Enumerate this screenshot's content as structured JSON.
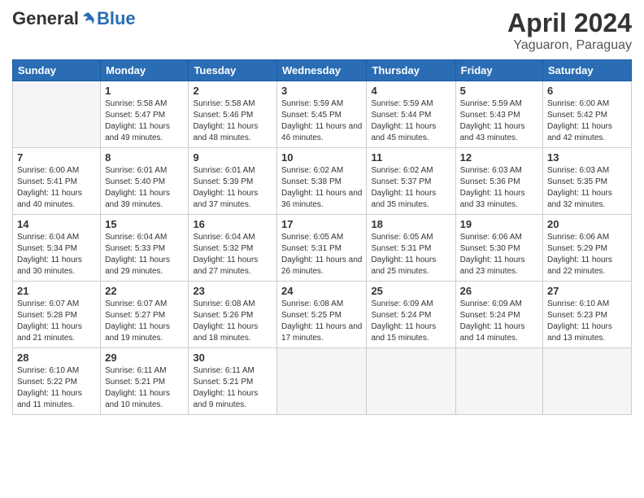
{
  "header": {
    "logo_general": "General",
    "logo_blue": "Blue",
    "month_title": "April 2024",
    "location": "Yaguaron, Paraguay"
  },
  "days_of_week": [
    "Sunday",
    "Monday",
    "Tuesday",
    "Wednesday",
    "Thursday",
    "Friday",
    "Saturday"
  ],
  "weeks": [
    [
      {
        "day": "",
        "info": ""
      },
      {
        "day": "1",
        "info": "Sunrise: 5:58 AM\nSunset: 5:47 PM\nDaylight: 11 hours\nand 49 minutes."
      },
      {
        "day": "2",
        "info": "Sunrise: 5:58 AM\nSunset: 5:46 PM\nDaylight: 11 hours\nand 48 minutes."
      },
      {
        "day": "3",
        "info": "Sunrise: 5:59 AM\nSunset: 5:45 PM\nDaylight: 11 hours\nand 46 minutes."
      },
      {
        "day": "4",
        "info": "Sunrise: 5:59 AM\nSunset: 5:44 PM\nDaylight: 11 hours\nand 45 minutes."
      },
      {
        "day": "5",
        "info": "Sunrise: 5:59 AM\nSunset: 5:43 PM\nDaylight: 11 hours\nand 43 minutes."
      },
      {
        "day": "6",
        "info": "Sunrise: 6:00 AM\nSunset: 5:42 PM\nDaylight: 11 hours\nand 42 minutes."
      }
    ],
    [
      {
        "day": "7",
        "info": "Sunrise: 6:00 AM\nSunset: 5:41 PM\nDaylight: 11 hours\nand 40 minutes."
      },
      {
        "day": "8",
        "info": "Sunrise: 6:01 AM\nSunset: 5:40 PM\nDaylight: 11 hours\nand 39 minutes."
      },
      {
        "day": "9",
        "info": "Sunrise: 6:01 AM\nSunset: 5:39 PM\nDaylight: 11 hours\nand 37 minutes."
      },
      {
        "day": "10",
        "info": "Sunrise: 6:02 AM\nSunset: 5:38 PM\nDaylight: 11 hours\nand 36 minutes."
      },
      {
        "day": "11",
        "info": "Sunrise: 6:02 AM\nSunset: 5:37 PM\nDaylight: 11 hours\nand 35 minutes."
      },
      {
        "day": "12",
        "info": "Sunrise: 6:03 AM\nSunset: 5:36 PM\nDaylight: 11 hours\nand 33 minutes."
      },
      {
        "day": "13",
        "info": "Sunrise: 6:03 AM\nSunset: 5:35 PM\nDaylight: 11 hours\nand 32 minutes."
      }
    ],
    [
      {
        "day": "14",
        "info": "Sunrise: 6:04 AM\nSunset: 5:34 PM\nDaylight: 11 hours\nand 30 minutes."
      },
      {
        "day": "15",
        "info": "Sunrise: 6:04 AM\nSunset: 5:33 PM\nDaylight: 11 hours\nand 29 minutes."
      },
      {
        "day": "16",
        "info": "Sunrise: 6:04 AM\nSunset: 5:32 PM\nDaylight: 11 hours\nand 27 minutes."
      },
      {
        "day": "17",
        "info": "Sunrise: 6:05 AM\nSunset: 5:31 PM\nDaylight: 11 hours\nand 26 minutes."
      },
      {
        "day": "18",
        "info": "Sunrise: 6:05 AM\nSunset: 5:31 PM\nDaylight: 11 hours\nand 25 minutes."
      },
      {
        "day": "19",
        "info": "Sunrise: 6:06 AM\nSunset: 5:30 PM\nDaylight: 11 hours\nand 23 minutes."
      },
      {
        "day": "20",
        "info": "Sunrise: 6:06 AM\nSunset: 5:29 PM\nDaylight: 11 hours\nand 22 minutes."
      }
    ],
    [
      {
        "day": "21",
        "info": "Sunrise: 6:07 AM\nSunset: 5:28 PM\nDaylight: 11 hours\nand 21 minutes."
      },
      {
        "day": "22",
        "info": "Sunrise: 6:07 AM\nSunset: 5:27 PM\nDaylight: 11 hours\nand 19 minutes."
      },
      {
        "day": "23",
        "info": "Sunrise: 6:08 AM\nSunset: 5:26 PM\nDaylight: 11 hours\nand 18 minutes."
      },
      {
        "day": "24",
        "info": "Sunrise: 6:08 AM\nSunset: 5:25 PM\nDaylight: 11 hours\nand 17 minutes."
      },
      {
        "day": "25",
        "info": "Sunrise: 6:09 AM\nSunset: 5:24 PM\nDaylight: 11 hours\nand 15 minutes."
      },
      {
        "day": "26",
        "info": "Sunrise: 6:09 AM\nSunset: 5:24 PM\nDaylight: 11 hours\nand 14 minutes."
      },
      {
        "day": "27",
        "info": "Sunrise: 6:10 AM\nSunset: 5:23 PM\nDaylight: 11 hours\nand 13 minutes."
      }
    ],
    [
      {
        "day": "28",
        "info": "Sunrise: 6:10 AM\nSunset: 5:22 PM\nDaylight: 11 hours\nand 11 minutes."
      },
      {
        "day": "29",
        "info": "Sunrise: 6:11 AM\nSunset: 5:21 PM\nDaylight: 11 hours\nand 10 minutes."
      },
      {
        "day": "30",
        "info": "Sunrise: 6:11 AM\nSunset: 5:21 PM\nDaylight: 11 hours\nand 9 minutes."
      },
      {
        "day": "",
        "info": ""
      },
      {
        "day": "",
        "info": ""
      },
      {
        "day": "",
        "info": ""
      },
      {
        "day": "",
        "info": ""
      }
    ]
  ]
}
